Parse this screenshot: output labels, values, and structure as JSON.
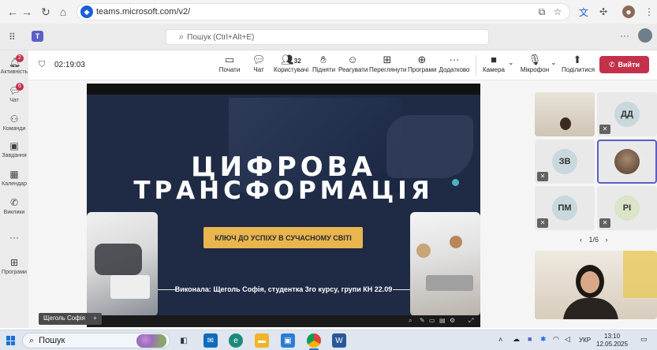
{
  "browser": {
    "url": "teams.microsoft.com/v2/"
  },
  "teams": {
    "search_placeholder": "Пошук (Ctrl+Alt+E)"
  },
  "rail": {
    "items": [
      {
        "label": "Активність",
        "badge": "2",
        "icon": "bell-icon"
      },
      {
        "label": "Чат",
        "badge": "6",
        "icon": "chat-icon"
      },
      {
        "label": "Команди",
        "icon": "teams-icon"
      },
      {
        "label": "Завдання",
        "icon": "tasks-icon"
      },
      {
        "label": "Календар",
        "icon": "calendar-icon"
      },
      {
        "label": "Виклики",
        "icon": "phone-icon"
      },
      {
        "label": "Програми",
        "icon": "apps-icon"
      }
    ]
  },
  "meeting": {
    "timer": "02:19:03",
    "toolbar": {
      "start": "Почати",
      "chat": "Чат",
      "people": "Користувачі",
      "people_count": "32",
      "raise": "Підняти",
      "react": "Реагувати",
      "view": "Переглянути",
      "apps": "Програми",
      "more": "Додатково",
      "camera": "Камера",
      "mic": "Мікрофон",
      "share": "Поділитися",
      "leave": "Вийти"
    }
  },
  "slide": {
    "title_line1": "ЦИФРОВА",
    "title_line2": "ТРАНСФОРМАЦІЯ",
    "cta": "КЛЮЧ ДО УСПІХУ В СУЧАСНОМУ СВІТІ",
    "author": "Виконала: Щеголь Софія, студентка 3го курсу, групи КН 22.09",
    "presenter_name": "Щеголь Софія"
  },
  "participants": {
    "tiles": [
      {
        "initials": "",
        "video": true
      },
      {
        "initials": "ДД"
      },
      {
        "initials": "ЗВ"
      },
      {
        "initials": "",
        "video": true
      },
      {
        "initials": "ПМ"
      },
      {
        "initials": "РІ"
      }
    ],
    "pager": "1/6"
  },
  "taskbar": {
    "search_placeholder": "Пошук",
    "language": "УКР",
    "time": "13:10",
    "date": "12.05.2025"
  },
  "colors": {
    "accent": "#5b5fc7",
    "leave": "#c4314b",
    "slide_bg": "#1f2b45",
    "cta": "#e8b54f"
  }
}
